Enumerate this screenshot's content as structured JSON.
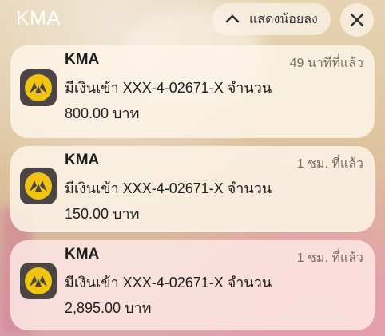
{
  "header": {
    "app_name": "KMA",
    "show_less_label": "แสดงน้อยลง"
  },
  "notifications": [
    {
      "title": "KMA",
      "time": "49 นาทีที่แล้ว",
      "message": "มีเงินเข้า XXX-4-02671-X จำนวน",
      "amount": "800.00 บาท"
    },
    {
      "title": "KMA",
      "time": "1 ชม. ที่แล้ว",
      "message": "มีเงินเข้า XXX-4-02671-X จำนวน",
      "amount": "150.00 บาท"
    },
    {
      "title": "KMA",
      "time": "1 ชม. ที่แล้ว",
      "message": "มีเงินเข้า XXX-4-02671-X จำนวน",
      "amount": "2,895.00 บาท"
    }
  ],
  "icons": {
    "show_less": "chevron-up-icon",
    "close": "close-icon",
    "app": "krungsri-app-icon"
  },
  "colors": {
    "icon_background": "#4b4645",
    "icon_accent": "#f1c40f"
  }
}
